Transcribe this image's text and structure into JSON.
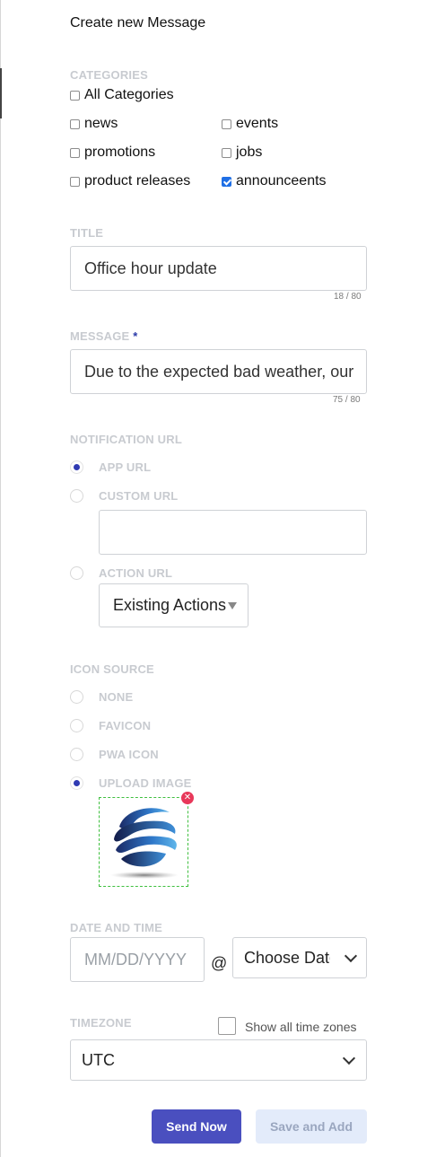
{
  "page": {
    "title": "Create new Message"
  },
  "categories": {
    "label": "CATEGORIES",
    "items": [
      {
        "label": "All Categories",
        "checked": false
      },
      {
        "label": "news",
        "checked": false
      },
      {
        "label": "events",
        "checked": false
      },
      {
        "label": "promotions",
        "checked": false
      },
      {
        "label": "jobs",
        "checked": false
      },
      {
        "label": "product releases",
        "checked": false
      },
      {
        "label": "announceents",
        "checked": true
      }
    ]
  },
  "title_field": {
    "label": "TITLE",
    "value": "Office hour update",
    "counter": "18 / 80"
  },
  "message_field": {
    "label": "MESSAGE",
    "required_mark": "*",
    "value": "Due to the expected bad weather, our",
    "counter": "75 / 80"
  },
  "notification_url": {
    "label": "NOTIFICATION URL",
    "options": [
      {
        "label": "APP URL",
        "selected": true
      },
      {
        "label": "CUSTOM URL",
        "selected": false
      },
      {
        "label": "ACTION URL",
        "selected": false
      }
    ],
    "custom_url_value": "",
    "action_select": {
      "value": "Existing Actions"
    }
  },
  "icon_source": {
    "label": "ICON SOURCE",
    "options": [
      {
        "label": "NONE",
        "selected": false
      },
      {
        "label": "FAVICON",
        "selected": false
      },
      {
        "label": "PWA ICON",
        "selected": false
      },
      {
        "label": "UPLOAD IMAGE",
        "selected": true
      }
    ]
  },
  "date_time": {
    "label": "DATE AND TIME",
    "date_placeholder": "MM/DD/YYYY",
    "at_sign": "@",
    "time_select": "Choose Date"
  },
  "timezone": {
    "label": "TIMEZONE",
    "show_all_label": "Show all time zones",
    "show_all_checked": false,
    "value": "UTC"
  },
  "actions": {
    "send_now": "Send Now",
    "save_and_add": "Save and Add"
  },
  "colors": {
    "primary": "#4a4fbf",
    "secondary_bg": "#e3ebfa",
    "radio_selected": "#2f3ab2",
    "checkbox_checked": "#1f6fe5",
    "remove_badge": "#e8385a"
  }
}
